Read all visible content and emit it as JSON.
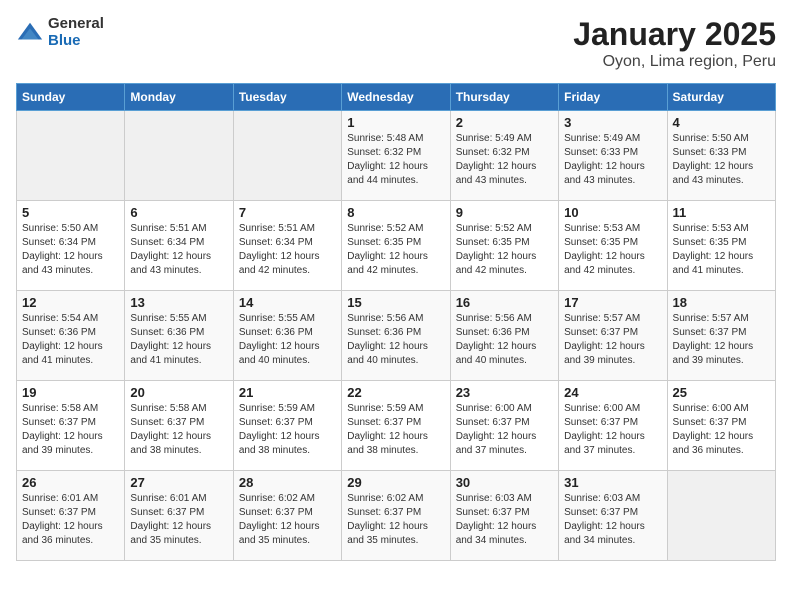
{
  "logo": {
    "general": "General",
    "blue": "Blue"
  },
  "title": "January 2025",
  "subtitle": "Oyon, Lima region, Peru",
  "days_of_week": [
    "Sunday",
    "Monday",
    "Tuesday",
    "Wednesday",
    "Thursday",
    "Friday",
    "Saturday"
  ],
  "weeks": [
    [
      {
        "num": "",
        "info": ""
      },
      {
        "num": "",
        "info": ""
      },
      {
        "num": "",
        "info": ""
      },
      {
        "num": "1",
        "info": "Sunrise: 5:48 AM\nSunset: 6:32 PM\nDaylight: 12 hours\nand 44 minutes."
      },
      {
        "num": "2",
        "info": "Sunrise: 5:49 AM\nSunset: 6:32 PM\nDaylight: 12 hours\nand 43 minutes."
      },
      {
        "num": "3",
        "info": "Sunrise: 5:49 AM\nSunset: 6:33 PM\nDaylight: 12 hours\nand 43 minutes."
      },
      {
        "num": "4",
        "info": "Sunrise: 5:50 AM\nSunset: 6:33 PM\nDaylight: 12 hours\nand 43 minutes."
      }
    ],
    [
      {
        "num": "5",
        "info": "Sunrise: 5:50 AM\nSunset: 6:34 PM\nDaylight: 12 hours\nand 43 minutes."
      },
      {
        "num": "6",
        "info": "Sunrise: 5:51 AM\nSunset: 6:34 PM\nDaylight: 12 hours\nand 43 minutes."
      },
      {
        "num": "7",
        "info": "Sunrise: 5:51 AM\nSunset: 6:34 PM\nDaylight: 12 hours\nand 42 minutes."
      },
      {
        "num": "8",
        "info": "Sunrise: 5:52 AM\nSunset: 6:35 PM\nDaylight: 12 hours\nand 42 minutes."
      },
      {
        "num": "9",
        "info": "Sunrise: 5:52 AM\nSunset: 6:35 PM\nDaylight: 12 hours\nand 42 minutes."
      },
      {
        "num": "10",
        "info": "Sunrise: 5:53 AM\nSunset: 6:35 PM\nDaylight: 12 hours\nand 42 minutes."
      },
      {
        "num": "11",
        "info": "Sunrise: 5:53 AM\nSunset: 6:35 PM\nDaylight: 12 hours\nand 41 minutes."
      }
    ],
    [
      {
        "num": "12",
        "info": "Sunrise: 5:54 AM\nSunset: 6:36 PM\nDaylight: 12 hours\nand 41 minutes."
      },
      {
        "num": "13",
        "info": "Sunrise: 5:55 AM\nSunset: 6:36 PM\nDaylight: 12 hours\nand 41 minutes."
      },
      {
        "num": "14",
        "info": "Sunrise: 5:55 AM\nSunset: 6:36 PM\nDaylight: 12 hours\nand 40 minutes."
      },
      {
        "num": "15",
        "info": "Sunrise: 5:56 AM\nSunset: 6:36 PM\nDaylight: 12 hours\nand 40 minutes."
      },
      {
        "num": "16",
        "info": "Sunrise: 5:56 AM\nSunset: 6:36 PM\nDaylight: 12 hours\nand 40 minutes."
      },
      {
        "num": "17",
        "info": "Sunrise: 5:57 AM\nSunset: 6:37 PM\nDaylight: 12 hours\nand 39 minutes."
      },
      {
        "num": "18",
        "info": "Sunrise: 5:57 AM\nSunset: 6:37 PM\nDaylight: 12 hours\nand 39 minutes."
      }
    ],
    [
      {
        "num": "19",
        "info": "Sunrise: 5:58 AM\nSunset: 6:37 PM\nDaylight: 12 hours\nand 39 minutes."
      },
      {
        "num": "20",
        "info": "Sunrise: 5:58 AM\nSunset: 6:37 PM\nDaylight: 12 hours\nand 38 minutes."
      },
      {
        "num": "21",
        "info": "Sunrise: 5:59 AM\nSunset: 6:37 PM\nDaylight: 12 hours\nand 38 minutes."
      },
      {
        "num": "22",
        "info": "Sunrise: 5:59 AM\nSunset: 6:37 PM\nDaylight: 12 hours\nand 38 minutes."
      },
      {
        "num": "23",
        "info": "Sunrise: 6:00 AM\nSunset: 6:37 PM\nDaylight: 12 hours\nand 37 minutes."
      },
      {
        "num": "24",
        "info": "Sunrise: 6:00 AM\nSunset: 6:37 PM\nDaylight: 12 hours\nand 37 minutes."
      },
      {
        "num": "25",
        "info": "Sunrise: 6:00 AM\nSunset: 6:37 PM\nDaylight: 12 hours\nand 36 minutes."
      }
    ],
    [
      {
        "num": "26",
        "info": "Sunrise: 6:01 AM\nSunset: 6:37 PM\nDaylight: 12 hours\nand 36 minutes."
      },
      {
        "num": "27",
        "info": "Sunrise: 6:01 AM\nSunset: 6:37 PM\nDaylight: 12 hours\nand 35 minutes."
      },
      {
        "num": "28",
        "info": "Sunrise: 6:02 AM\nSunset: 6:37 PM\nDaylight: 12 hours\nand 35 minutes."
      },
      {
        "num": "29",
        "info": "Sunrise: 6:02 AM\nSunset: 6:37 PM\nDaylight: 12 hours\nand 35 minutes."
      },
      {
        "num": "30",
        "info": "Sunrise: 6:03 AM\nSunset: 6:37 PM\nDaylight: 12 hours\nand 34 minutes."
      },
      {
        "num": "31",
        "info": "Sunrise: 6:03 AM\nSunset: 6:37 PM\nDaylight: 12 hours\nand 34 minutes."
      },
      {
        "num": "",
        "info": ""
      }
    ]
  ]
}
